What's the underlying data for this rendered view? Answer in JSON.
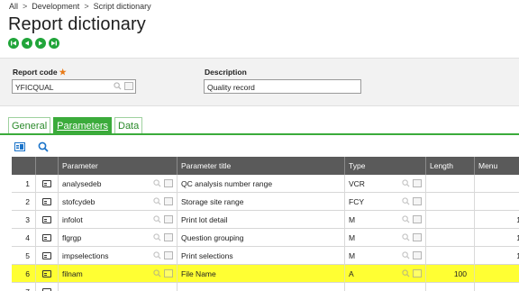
{
  "breadcrumb": {
    "items": [
      "All",
      "Development",
      "Script dictionary"
    ],
    "separator": ">"
  },
  "page_title": "Report dictionary",
  "nav_buttons": [
    "first-icon",
    "previous-icon",
    "next-icon",
    "last-icon"
  ],
  "header_form": {
    "report_code_label": "Report code",
    "report_code_required": "★",
    "report_code_value": "YFICQUAL",
    "description_label": "Description",
    "description_value": "Quality record"
  },
  "tabs": [
    {
      "label": "General",
      "active": false
    },
    {
      "label": "Parameters",
      "active": true
    },
    {
      "label": "Data",
      "active": false
    }
  ],
  "grid": {
    "columns": [
      "Parameter",
      "Parameter title",
      "Type",
      "Length",
      "Menu"
    ],
    "rows": [
      {
        "num": "1",
        "parameter": "analysedeb",
        "title": "QC analysis number range",
        "type": "VCR",
        "length": "",
        "menu": "",
        "highlighted": false
      },
      {
        "num": "2",
        "parameter": "stofcydeb",
        "title": "Storage site range",
        "type": "FCY",
        "length": "",
        "menu": "",
        "highlighted": false
      },
      {
        "num": "3",
        "parameter": "infolot",
        "title": "Print lot detail",
        "type": "M",
        "length": "",
        "menu": "1",
        "highlighted": false
      },
      {
        "num": "4",
        "parameter": "flgrgp",
        "title": "Question grouping",
        "type": "M",
        "length": "",
        "menu": "1",
        "highlighted": false
      },
      {
        "num": "5",
        "parameter": "impselections",
        "title": "Print selections",
        "type": "M",
        "length": "",
        "menu": "1",
        "highlighted": false
      },
      {
        "num": "6",
        "parameter": "filnam",
        "title": "File Name",
        "type": "A",
        "length": "100",
        "menu": "",
        "highlighted": true
      },
      {
        "num": "7",
        "parameter": "",
        "title": "",
        "type": "",
        "length": "",
        "menu": "",
        "highlighted": false
      }
    ]
  },
  "colors": {
    "accent_green": "#3bab3b",
    "nav_green": "#21a53a",
    "highlight": "#ffff33",
    "required": "#e87a16"
  }
}
